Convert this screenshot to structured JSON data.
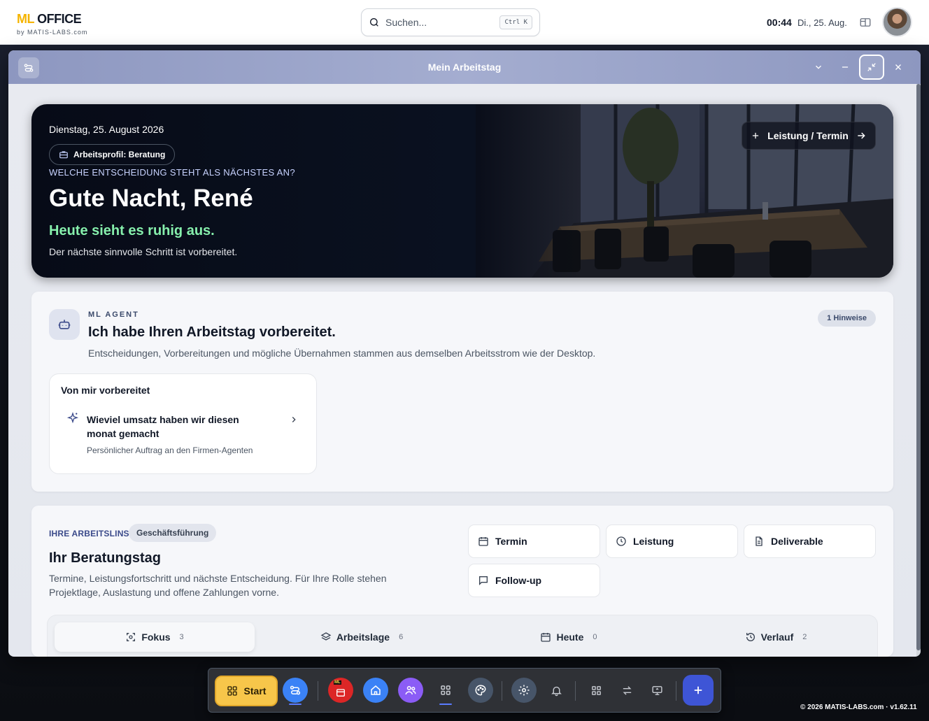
{
  "topbar": {
    "logo_ml": "ML",
    "logo_office": " OFFICE",
    "logo_sub": "by MATIS-LABS.com",
    "search_placeholder": "Suchen...",
    "search_shortcut": "Ctrl K",
    "time": "00:44",
    "date": "Di., 25. Aug."
  },
  "window": {
    "title": "Mein Arbeitstag"
  },
  "hero": {
    "date": "Dienstag, 25. August 2026",
    "profile_chip": "Arbeitsprofil: Beratung",
    "question": "WELCHE ENTSCHEIDUNG STEHT ALS NÄCHSTES AN?",
    "greeting": "Gute Nacht, René",
    "status": "Heute sieht es ruhig aus.",
    "subtitle": "Der nächste sinnvolle Schritt ist vorbereitet.",
    "action_button": "Leistung / Termin"
  },
  "agent": {
    "kicker": "ML AGENT",
    "heading": "Ich habe Ihren Arbeitstag vorbereitet.",
    "description": "Entscheidungen, Vorbereitungen und mögliche Übernahmen stammen aus demselben Arbeitsstrom wie der Desktop.",
    "badge": "1 Hinweise",
    "prepared": {
      "title": "Von mir vorbereitet",
      "item_title": "Wieviel umsatz haben wir diesen monat gemacht",
      "item_sub": "Persönlicher Auftrag an den Firmen-Agenten"
    }
  },
  "lens": {
    "kicker": "IHRE ARBEITSLINSE",
    "chip": "Geschäftsführung",
    "heading": "Ihr Beratungstag",
    "description": "Termine, Leistungsfortschritt und nächste Entscheidung. Für Ihre Rolle stehen Projektlage, Auslastung und offene Zahlungen vorne.",
    "quick_actions": [
      "Termin",
      "Leistung",
      "Deliverable",
      "Follow-up"
    ],
    "tabs": [
      {
        "label": "Fokus",
        "count": "3"
      },
      {
        "label": "Arbeitslage",
        "count": "6"
      },
      {
        "label": "Heute",
        "count": "0"
      },
      {
        "label": "Verlauf",
        "count": "2"
      }
    ]
  },
  "dock": {
    "start_label": "Start",
    "calendar_badge": "ML"
  },
  "footer": "© 2026 MATIS-LABS.com · v1.62.11"
}
